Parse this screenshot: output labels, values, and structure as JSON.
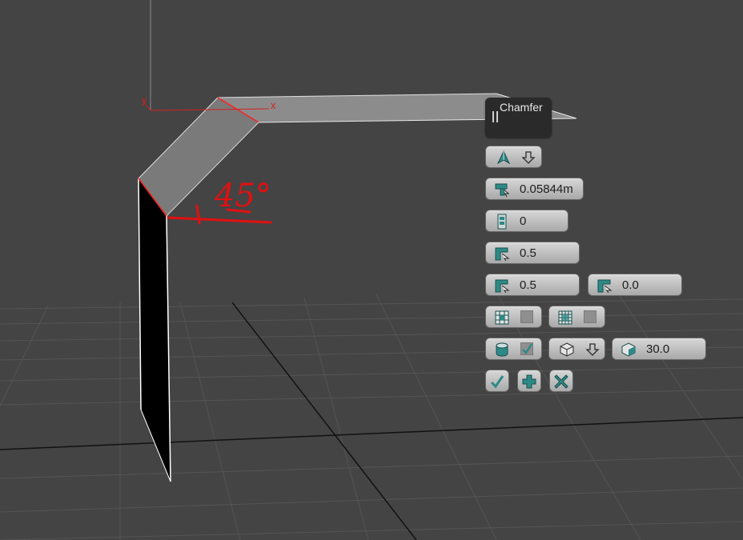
{
  "viewport": {
    "background": "#444444",
    "axis_labels": {
      "x": "x",
      "y": "y"
    },
    "annotation": {
      "text": "45°",
      "color": "#e01010"
    }
  },
  "caddy": {
    "title": "Chamfer",
    "row_mode": {
      "icons": [
        "chamfer-type-icon",
        "dropdown-arrow-icon"
      ]
    },
    "amount": {
      "value": "0.05844m",
      "icon": "chamfer-amount-icon"
    },
    "segments": {
      "value": "0",
      "icon": "segments-icon"
    },
    "tension": {
      "value": "0.5",
      "icon": "tension-icon"
    },
    "depth": {
      "value": "0.5",
      "icon": "depth-icon"
    },
    "end_bias": {
      "value": "0.0",
      "icon": "end-bias-icon"
    },
    "radial_bias": {
      "icon": "radial-bias-icon"
    },
    "intersection_bias": {
      "icon": "intersection-bias-icon"
    },
    "smooth": {
      "icon": "smooth-icon",
      "checked": true
    },
    "smooth_mode": {
      "icon": "smooth-type-icon"
    },
    "threshold": {
      "value": "30.0",
      "icon": "threshold-icon"
    },
    "actions": {
      "ok_icon": "ok-check-icon",
      "apply_icon": "apply-plus-icon",
      "cancel_icon": "cancel-x-icon"
    },
    "accent": "#2e8a87"
  }
}
